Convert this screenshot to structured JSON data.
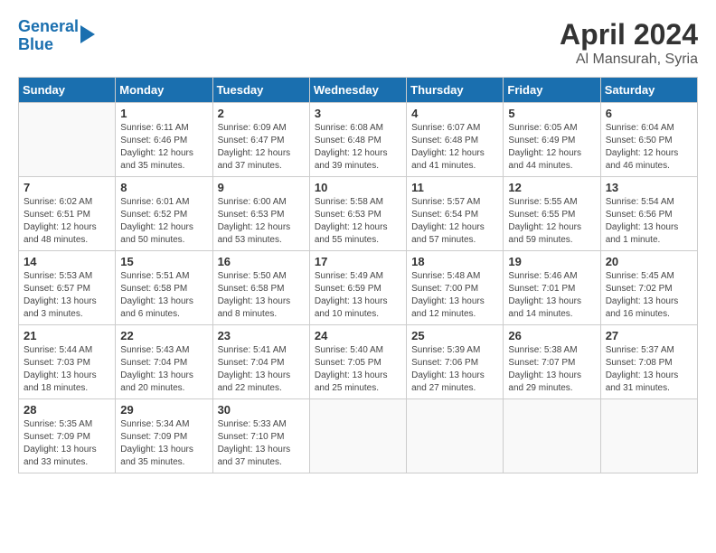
{
  "header": {
    "logo_line1": "General",
    "logo_line2": "Blue",
    "month": "April 2024",
    "location": "Al Mansurah, Syria"
  },
  "weekdays": [
    "Sunday",
    "Monday",
    "Tuesday",
    "Wednesday",
    "Thursday",
    "Friday",
    "Saturday"
  ],
  "weeks": [
    [
      {
        "day": "",
        "sunrise": "",
        "sunset": "",
        "daylight": ""
      },
      {
        "day": "1",
        "sunrise": "Sunrise: 6:11 AM",
        "sunset": "Sunset: 6:46 PM",
        "daylight": "Daylight: 12 hours and 35 minutes."
      },
      {
        "day": "2",
        "sunrise": "Sunrise: 6:09 AM",
        "sunset": "Sunset: 6:47 PM",
        "daylight": "Daylight: 12 hours and 37 minutes."
      },
      {
        "day": "3",
        "sunrise": "Sunrise: 6:08 AM",
        "sunset": "Sunset: 6:48 PM",
        "daylight": "Daylight: 12 hours and 39 minutes."
      },
      {
        "day": "4",
        "sunrise": "Sunrise: 6:07 AM",
        "sunset": "Sunset: 6:48 PM",
        "daylight": "Daylight: 12 hours and 41 minutes."
      },
      {
        "day": "5",
        "sunrise": "Sunrise: 6:05 AM",
        "sunset": "Sunset: 6:49 PM",
        "daylight": "Daylight: 12 hours and 44 minutes."
      },
      {
        "day": "6",
        "sunrise": "Sunrise: 6:04 AM",
        "sunset": "Sunset: 6:50 PM",
        "daylight": "Daylight: 12 hours and 46 minutes."
      }
    ],
    [
      {
        "day": "7",
        "sunrise": "Sunrise: 6:02 AM",
        "sunset": "Sunset: 6:51 PM",
        "daylight": "Daylight: 12 hours and 48 minutes."
      },
      {
        "day": "8",
        "sunrise": "Sunrise: 6:01 AM",
        "sunset": "Sunset: 6:52 PM",
        "daylight": "Daylight: 12 hours and 50 minutes."
      },
      {
        "day": "9",
        "sunrise": "Sunrise: 6:00 AM",
        "sunset": "Sunset: 6:53 PM",
        "daylight": "Daylight: 12 hours and 53 minutes."
      },
      {
        "day": "10",
        "sunrise": "Sunrise: 5:58 AM",
        "sunset": "Sunset: 6:53 PM",
        "daylight": "Daylight: 12 hours and 55 minutes."
      },
      {
        "day": "11",
        "sunrise": "Sunrise: 5:57 AM",
        "sunset": "Sunset: 6:54 PM",
        "daylight": "Daylight: 12 hours and 57 minutes."
      },
      {
        "day": "12",
        "sunrise": "Sunrise: 5:55 AM",
        "sunset": "Sunset: 6:55 PM",
        "daylight": "Daylight: 12 hours and 59 minutes."
      },
      {
        "day": "13",
        "sunrise": "Sunrise: 5:54 AM",
        "sunset": "Sunset: 6:56 PM",
        "daylight": "Daylight: 13 hours and 1 minute."
      }
    ],
    [
      {
        "day": "14",
        "sunrise": "Sunrise: 5:53 AM",
        "sunset": "Sunset: 6:57 PM",
        "daylight": "Daylight: 13 hours and 3 minutes."
      },
      {
        "day": "15",
        "sunrise": "Sunrise: 5:51 AM",
        "sunset": "Sunset: 6:58 PM",
        "daylight": "Daylight: 13 hours and 6 minutes."
      },
      {
        "day": "16",
        "sunrise": "Sunrise: 5:50 AM",
        "sunset": "Sunset: 6:58 PM",
        "daylight": "Daylight: 13 hours and 8 minutes."
      },
      {
        "day": "17",
        "sunrise": "Sunrise: 5:49 AM",
        "sunset": "Sunset: 6:59 PM",
        "daylight": "Daylight: 13 hours and 10 minutes."
      },
      {
        "day": "18",
        "sunrise": "Sunrise: 5:48 AM",
        "sunset": "Sunset: 7:00 PM",
        "daylight": "Daylight: 13 hours and 12 minutes."
      },
      {
        "day": "19",
        "sunrise": "Sunrise: 5:46 AM",
        "sunset": "Sunset: 7:01 PM",
        "daylight": "Daylight: 13 hours and 14 minutes."
      },
      {
        "day": "20",
        "sunrise": "Sunrise: 5:45 AM",
        "sunset": "Sunset: 7:02 PM",
        "daylight": "Daylight: 13 hours and 16 minutes."
      }
    ],
    [
      {
        "day": "21",
        "sunrise": "Sunrise: 5:44 AM",
        "sunset": "Sunset: 7:03 PM",
        "daylight": "Daylight: 13 hours and 18 minutes."
      },
      {
        "day": "22",
        "sunrise": "Sunrise: 5:43 AM",
        "sunset": "Sunset: 7:04 PM",
        "daylight": "Daylight: 13 hours and 20 minutes."
      },
      {
        "day": "23",
        "sunrise": "Sunrise: 5:41 AM",
        "sunset": "Sunset: 7:04 PM",
        "daylight": "Daylight: 13 hours and 22 minutes."
      },
      {
        "day": "24",
        "sunrise": "Sunrise: 5:40 AM",
        "sunset": "Sunset: 7:05 PM",
        "daylight": "Daylight: 13 hours and 25 minutes."
      },
      {
        "day": "25",
        "sunrise": "Sunrise: 5:39 AM",
        "sunset": "Sunset: 7:06 PM",
        "daylight": "Daylight: 13 hours and 27 minutes."
      },
      {
        "day": "26",
        "sunrise": "Sunrise: 5:38 AM",
        "sunset": "Sunset: 7:07 PM",
        "daylight": "Daylight: 13 hours and 29 minutes."
      },
      {
        "day": "27",
        "sunrise": "Sunrise: 5:37 AM",
        "sunset": "Sunset: 7:08 PM",
        "daylight": "Daylight: 13 hours and 31 minutes."
      }
    ],
    [
      {
        "day": "28",
        "sunrise": "Sunrise: 5:35 AM",
        "sunset": "Sunset: 7:09 PM",
        "daylight": "Daylight: 13 hours and 33 minutes."
      },
      {
        "day": "29",
        "sunrise": "Sunrise: 5:34 AM",
        "sunset": "Sunset: 7:09 PM",
        "daylight": "Daylight: 13 hours and 35 minutes."
      },
      {
        "day": "30",
        "sunrise": "Sunrise: 5:33 AM",
        "sunset": "Sunset: 7:10 PM",
        "daylight": "Daylight: 13 hours and 37 minutes."
      },
      {
        "day": "",
        "sunrise": "",
        "sunset": "",
        "daylight": ""
      },
      {
        "day": "",
        "sunrise": "",
        "sunset": "",
        "daylight": ""
      },
      {
        "day": "",
        "sunrise": "",
        "sunset": "",
        "daylight": ""
      },
      {
        "day": "",
        "sunrise": "",
        "sunset": "",
        "daylight": ""
      }
    ]
  ]
}
